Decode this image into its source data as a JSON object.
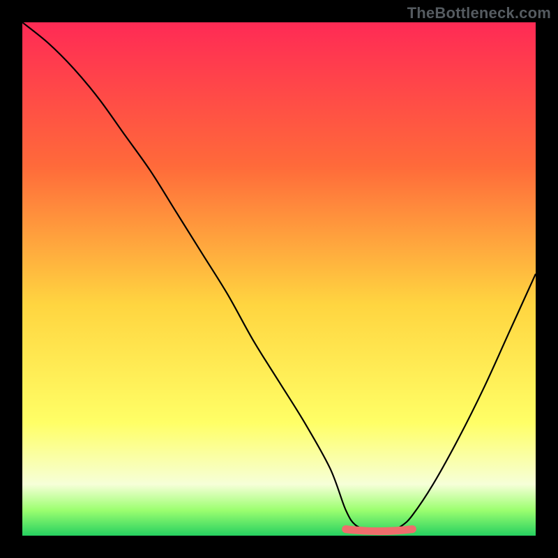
{
  "watermark": "TheBottleneck.com",
  "colors": {
    "frame_bg": "#000000",
    "grad_top": "#ff2a55",
    "grad_mid1": "#ff6a3a",
    "grad_mid2": "#ffd540",
    "grad_mid3": "#ffff66",
    "grad_lowpale": "#f6ffd8",
    "grad_green_light": "#9cff70",
    "grad_green": "#26d060",
    "curve": "#000000",
    "highlight": "#ef6e6c"
  },
  "chart_data": {
    "type": "line",
    "title": "",
    "xlabel": "",
    "ylabel": "",
    "xlim": [
      0,
      100
    ],
    "ylim": [
      0,
      100
    ],
    "x": [
      0,
      5,
      10,
      15,
      20,
      25,
      30,
      35,
      40,
      45,
      50,
      55,
      60,
      63,
      65,
      68,
      70,
      72,
      74,
      76,
      80,
      85,
      90,
      95,
      100
    ],
    "y": [
      100,
      96,
      91,
      85,
      78,
      71,
      63,
      55,
      47,
      38,
      30,
      22,
      13,
      5,
      2,
      1,
      1,
      1,
      2,
      4,
      10,
      19,
      29,
      40,
      51
    ],
    "highlight_segment": {
      "x_start": 63,
      "x_end": 76,
      "y": 1
    }
  }
}
